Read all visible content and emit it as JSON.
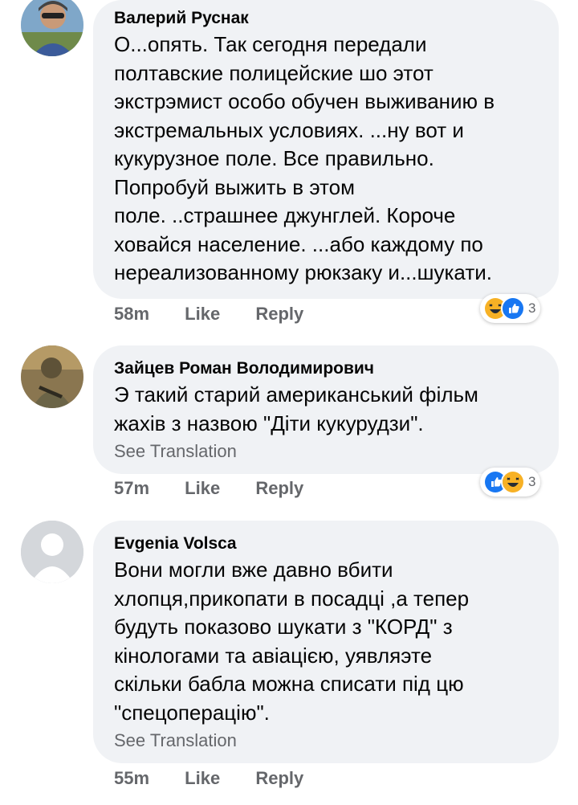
{
  "comments": [
    {
      "author": "Валерий Руснак",
      "lines": "О...опять. Так сегодня передали\nполтавские полицейские шо этот\nэкстрэмист особо обучен выживанию в\nэкстремальных условиях. ...ну вот и\nкукурузное поле. Все правильно.\nПопробуй выжить в этом\nполе. ..страшнее джунглей. Короче\nховайся население. ...або каждому по\nнереализованному рюкзаку и...шукати.",
      "see_translation": "",
      "time": "58m",
      "like": "Like",
      "reply": "Reply",
      "reaction_count": "3",
      "reactions": [
        "haha-icon",
        "like-icon"
      ]
    },
    {
      "author": "Зайцев Роман Володимирович",
      "lines": "Э такий старий американський фільм\nжахів з назвою \"Діти кукурудзи\".",
      "see_translation": "See Translation",
      "time": "57m",
      "like": "Like",
      "reply": "Reply",
      "reaction_count": "3",
      "reactions": [
        "like-icon",
        "haha-icon"
      ]
    },
    {
      "author": "Evgenia Volsca",
      "lines": "Вони могли вже давно вбити\nхлопця,прикопати в посадці ,а тепер\nбудуть показово шукати з \"КОРД\" з\nкінологами та авіацією, уявляэте\nскільки бабла можна списати під цю\n\"спецоперацію\".",
      "see_translation": "See Translation",
      "time": "55m",
      "like": "Like",
      "reply": "Reply",
      "reaction_count": "",
      "reactions": []
    }
  ],
  "colors": {
    "bubble": "#f0f2f5",
    "meta_text": "#65676b",
    "like_blue": "#1877f2",
    "haha_yellow": "#f7b125"
  }
}
